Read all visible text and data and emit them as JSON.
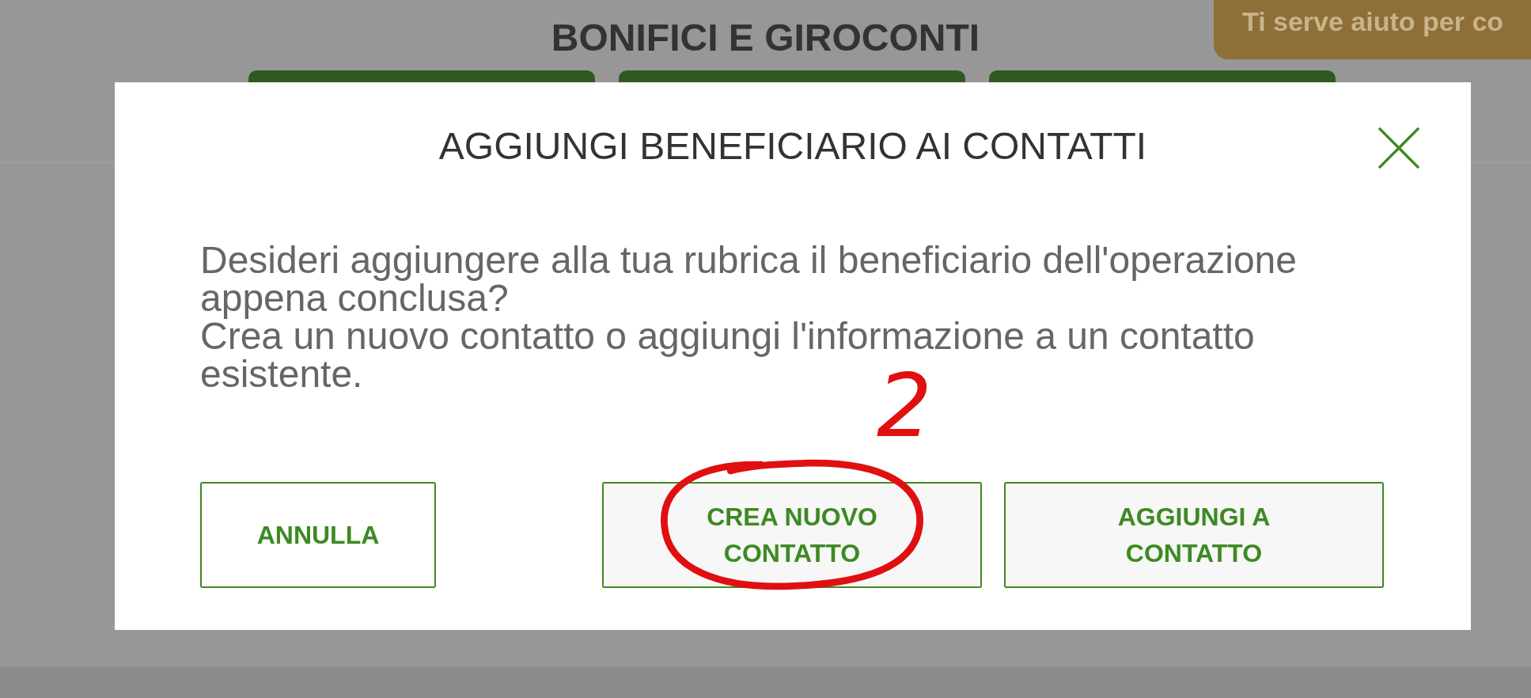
{
  "page": {
    "title": "BONIFICI E GIROCONTI",
    "help_tab": "Ti serve aiuto per co"
  },
  "dialog": {
    "title": "AGGIUNGI BENEFICIARIO AI CONTATTI",
    "message": [
      "Desideri aggiungere alla tua rubrica il beneficiario dell'operazione appena conclusa?",
      "Crea un nuovo contatto o aggiungi l'informazione a un contatto esistente."
    ],
    "buttons": [
      {
        "label": "ANNULLA",
        "highlighted": false
      },
      {
        "label": "CREA NUOVO CONTATTO",
        "highlighted": true
      },
      {
        "label": "AGGIUNGI A CONTATTO",
        "highlighted": false
      }
    ]
  },
  "annotation": {
    "label": "2"
  }
}
